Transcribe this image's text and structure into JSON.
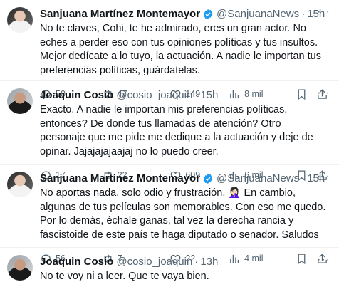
{
  "tweets": [
    {
      "name": "Sanjuana Martínez Montemayor",
      "handle": "@SanjuanaNews",
      "time": "15h",
      "text": "No te claves, Cohi, te he admirado, eres un gran actor. No eches a perder eso con tus opiniones políticas y tus insultos. Mejor dedícate a lo tuyo, la actuación. A nadie le importan tus preferencias políticas, guárdatelas.",
      "replies": "50",
      "retweets": "47",
      "likes": "149",
      "views": "8 mil",
      "verified": true
    },
    {
      "name": "Joaquin Cosio",
      "handle": "@cosio_joaquin",
      "time": "15h",
      "text": "Exacto. A nadie le importan mis preferencias políticas, entonces? De donde tus llamadas de atención? Otro personaje que me pide me dedique a la actuación y deje de opinar. Jajajajajaajaj no lo puedo creer.",
      "replies": "17",
      "retweets": "22",
      "likes": "609",
      "views": "6 mil",
      "verified": false
    },
    {
      "name": "Sanjuana Martínez Montemayor",
      "handle": "@SanjuanaNews",
      "time": "15h",
      "text": "No aportas nada, solo odio y frustración. 🤦🏻‍♀️ En cambio, algunas de tus películas son memorables. Con eso me quedo. Por lo demás, échale ganas, tal vez la derecha rancia y fascistoide de este país te haga diputado o senador. Saludos",
      "replies": "56",
      "retweets": "7",
      "likes": "22",
      "views": "4 mil",
      "verified": true
    },
    {
      "name": "Joaquin Cosio",
      "handle": "@cosio_joaquin",
      "time": "13h",
      "text": "No te voy ni a leer. Que te vaya bien.",
      "verified": false
    }
  ],
  "separator": "·",
  "more_glyph": "···",
  "colors": {
    "verified": "#1d9bf0",
    "muted": "#536471",
    "text": "#0f1419",
    "divider": "#eff3f4"
  },
  "icons": [
    "reply-icon",
    "retweet-icon",
    "like-icon",
    "views-icon",
    "bookmark-icon",
    "share-icon",
    "more-icon",
    "verified-badge-icon"
  ]
}
